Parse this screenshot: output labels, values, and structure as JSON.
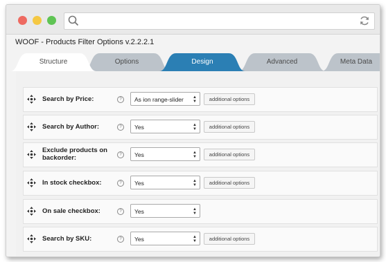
{
  "window": {
    "title": "WOOF - Products Filter Options v.2.2.2.1"
  },
  "browser": {
    "search_icon": "magnifier-icon",
    "reload_icon": "reload-icon"
  },
  "tabs": [
    {
      "label": "Structure",
      "state": "active"
    },
    {
      "label": "Options",
      "state": "inactive"
    },
    {
      "label": "Design",
      "state": "highlighted"
    },
    {
      "label": "Advanced",
      "state": "inactive"
    },
    {
      "label": "Meta Data",
      "state": "inactive"
    }
  ],
  "colors": {
    "design_tab": "#2b7fb4",
    "inactive_tab": "#bcc3ca",
    "active_tab": "#ffffff"
  },
  "rows": [
    {
      "label": "Search by Price:",
      "value": "As ion range-slider",
      "extra": "additional options"
    },
    {
      "label": "Search by Author:",
      "value": "Yes",
      "extra": "additional options"
    },
    {
      "label": "Exclude products on backorder:",
      "value": "Yes",
      "extra": "additional options"
    },
    {
      "label": "In stock checkbox:",
      "value": "Yes",
      "extra": "additional options"
    },
    {
      "label": "On sale checkbox:",
      "value": "Yes",
      "extra": ""
    },
    {
      "label": "Search by SKU:",
      "value": "Yes",
      "extra": "additional options"
    }
  ],
  "help_glyph": "?"
}
